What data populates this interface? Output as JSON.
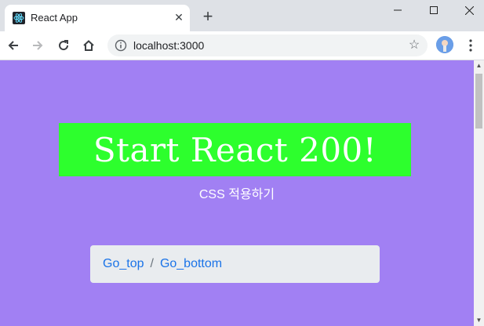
{
  "browser": {
    "tab_title": "React App",
    "url": "localhost:3000"
  },
  "page": {
    "hero_title": "Start React 200!",
    "subtitle": "CSS 적용하기",
    "breadcrumb": {
      "items": [
        "Go_top",
        "Go_bottom"
      ],
      "separator": "/"
    }
  },
  "colors": {
    "page_bg": "#a180f3",
    "hero_bg": "#2dff2d",
    "link": "#1a73e8",
    "breadcrumb_bg": "#e9ecef"
  }
}
